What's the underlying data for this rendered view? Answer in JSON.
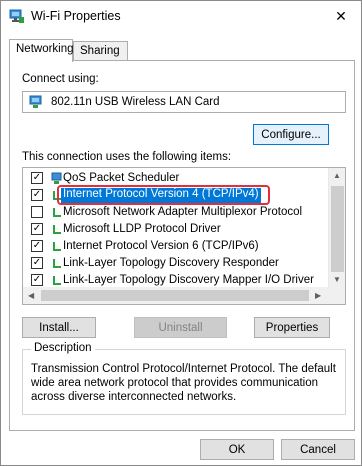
{
  "window": {
    "title": "Wi-Fi Properties",
    "close_glyph": "✕"
  },
  "tabs": [
    {
      "label": "Networking",
      "active": true
    },
    {
      "label": "Sharing",
      "active": false
    }
  ],
  "connect": {
    "label": "Connect using:",
    "adapter": "802.11n USB Wireless LAN Card",
    "configure_label": "Configure..."
  },
  "items_label": "This connection uses the following items:",
  "items": [
    {
      "label": "QoS Packet Scheduler",
      "checked": true,
      "icon": "network-service-icon"
    },
    {
      "label": "Internet Protocol Version 4 (TCP/IPv4)",
      "checked": true,
      "selected": true,
      "icon": "protocol-icon"
    },
    {
      "label": "Microsoft Network Adapter Multiplexor Protocol",
      "checked": false,
      "icon": "protocol-icon"
    },
    {
      "label": "Microsoft LLDP Protocol Driver",
      "checked": true,
      "icon": "protocol-icon"
    },
    {
      "label": "Internet Protocol Version 6 (TCP/IPv6)",
      "checked": true,
      "icon": "protocol-icon"
    },
    {
      "label": "Link-Layer Topology Discovery Responder",
      "checked": true,
      "icon": "protocol-icon"
    },
    {
      "label": "Link-Layer Topology Discovery Mapper I/O Driver",
      "checked": true,
      "icon": "protocol-icon"
    }
  ],
  "buttons": {
    "install": "Install...",
    "uninstall": "Uninstall",
    "properties": "Properties",
    "ok": "OK",
    "cancel": "Cancel"
  },
  "description": {
    "title": "Description",
    "text": "Transmission Control Protocol/Internet Protocol. The default wide area network protocol that provides communication across diverse interconnected networks."
  },
  "colors": {
    "accent": "#0078d7",
    "highlight_ring": "#e0303b",
    "protocol_icon": "#2ea043"
  }
}
